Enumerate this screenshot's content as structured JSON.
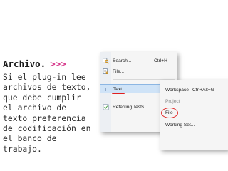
{
  "heading": {
    "title": "Archivo.",
    "arrows": ">>>"
  },
  "body_text": "Si el plug-in lee archivos de texto, que debe cumplir el archivo de texto preferencia de codificación en el banco de trabajo.",
  "menu": {
    "search_label": "Search...",
    "search_shortcut": "Ctrl+H",
    "file_label": "File...",
    "text_label": "Text",
    "text_arrow": "▸",
    "referring_label": "Referring Tests..."
  },
  "submenu": {
    "workspace_label": "Workspace",
    "workspace_shortcut": "Ctrl+Alt+G",
    "project_label": "Project",
    "file_label": "File",
    "working_set_label": "Working Set..."
  },
  "colors": {
    "accent_arrows": "#d73a8c",
    "annotation_red": "#e02020",
    "selection": "#cfe3f7"
  }
}
